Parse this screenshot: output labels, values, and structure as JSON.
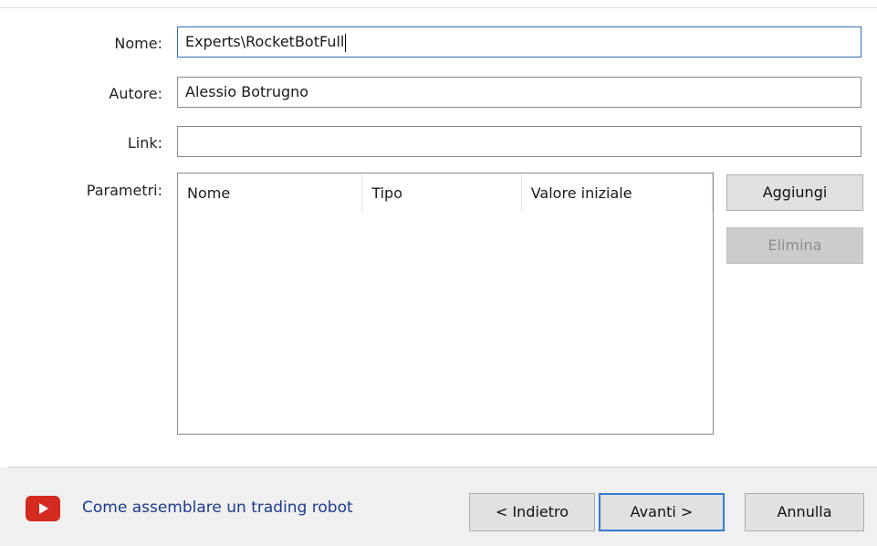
{
  "form": {
    "name_label": "Nome:",
    "name_value": "Experts\\RocketBotFull",
    "author_label": "Autore:",
    "author_value": "Alessio Botrugno",
    "link_label": "Link:",
    "link_value": "",
    "params_label": "Parametri:"
  },
  "params_table": {
    "columns": [
      "Nome",
      "Tipo",
      "Valore iniziale"
    ],
    "rows": []
  },
  "side_buttons": {
    "add_label": "Aggiungi",
    "delete_label": "Elimina"
  },
  "footer": {
    "video_icon": "youtube-play-icon",
    "help_link_text": "Come assemblare un trading robot",
    "back_label": "< Indietro",
    "next_label": "Avanti >",
    "cancel_label": "Annulla"
  },
  "colors": {
    "link": "#1e3a8f",
    "focus_border": "#2f7bd4",
    "youtube_red": "#d42a20"
  }
}
